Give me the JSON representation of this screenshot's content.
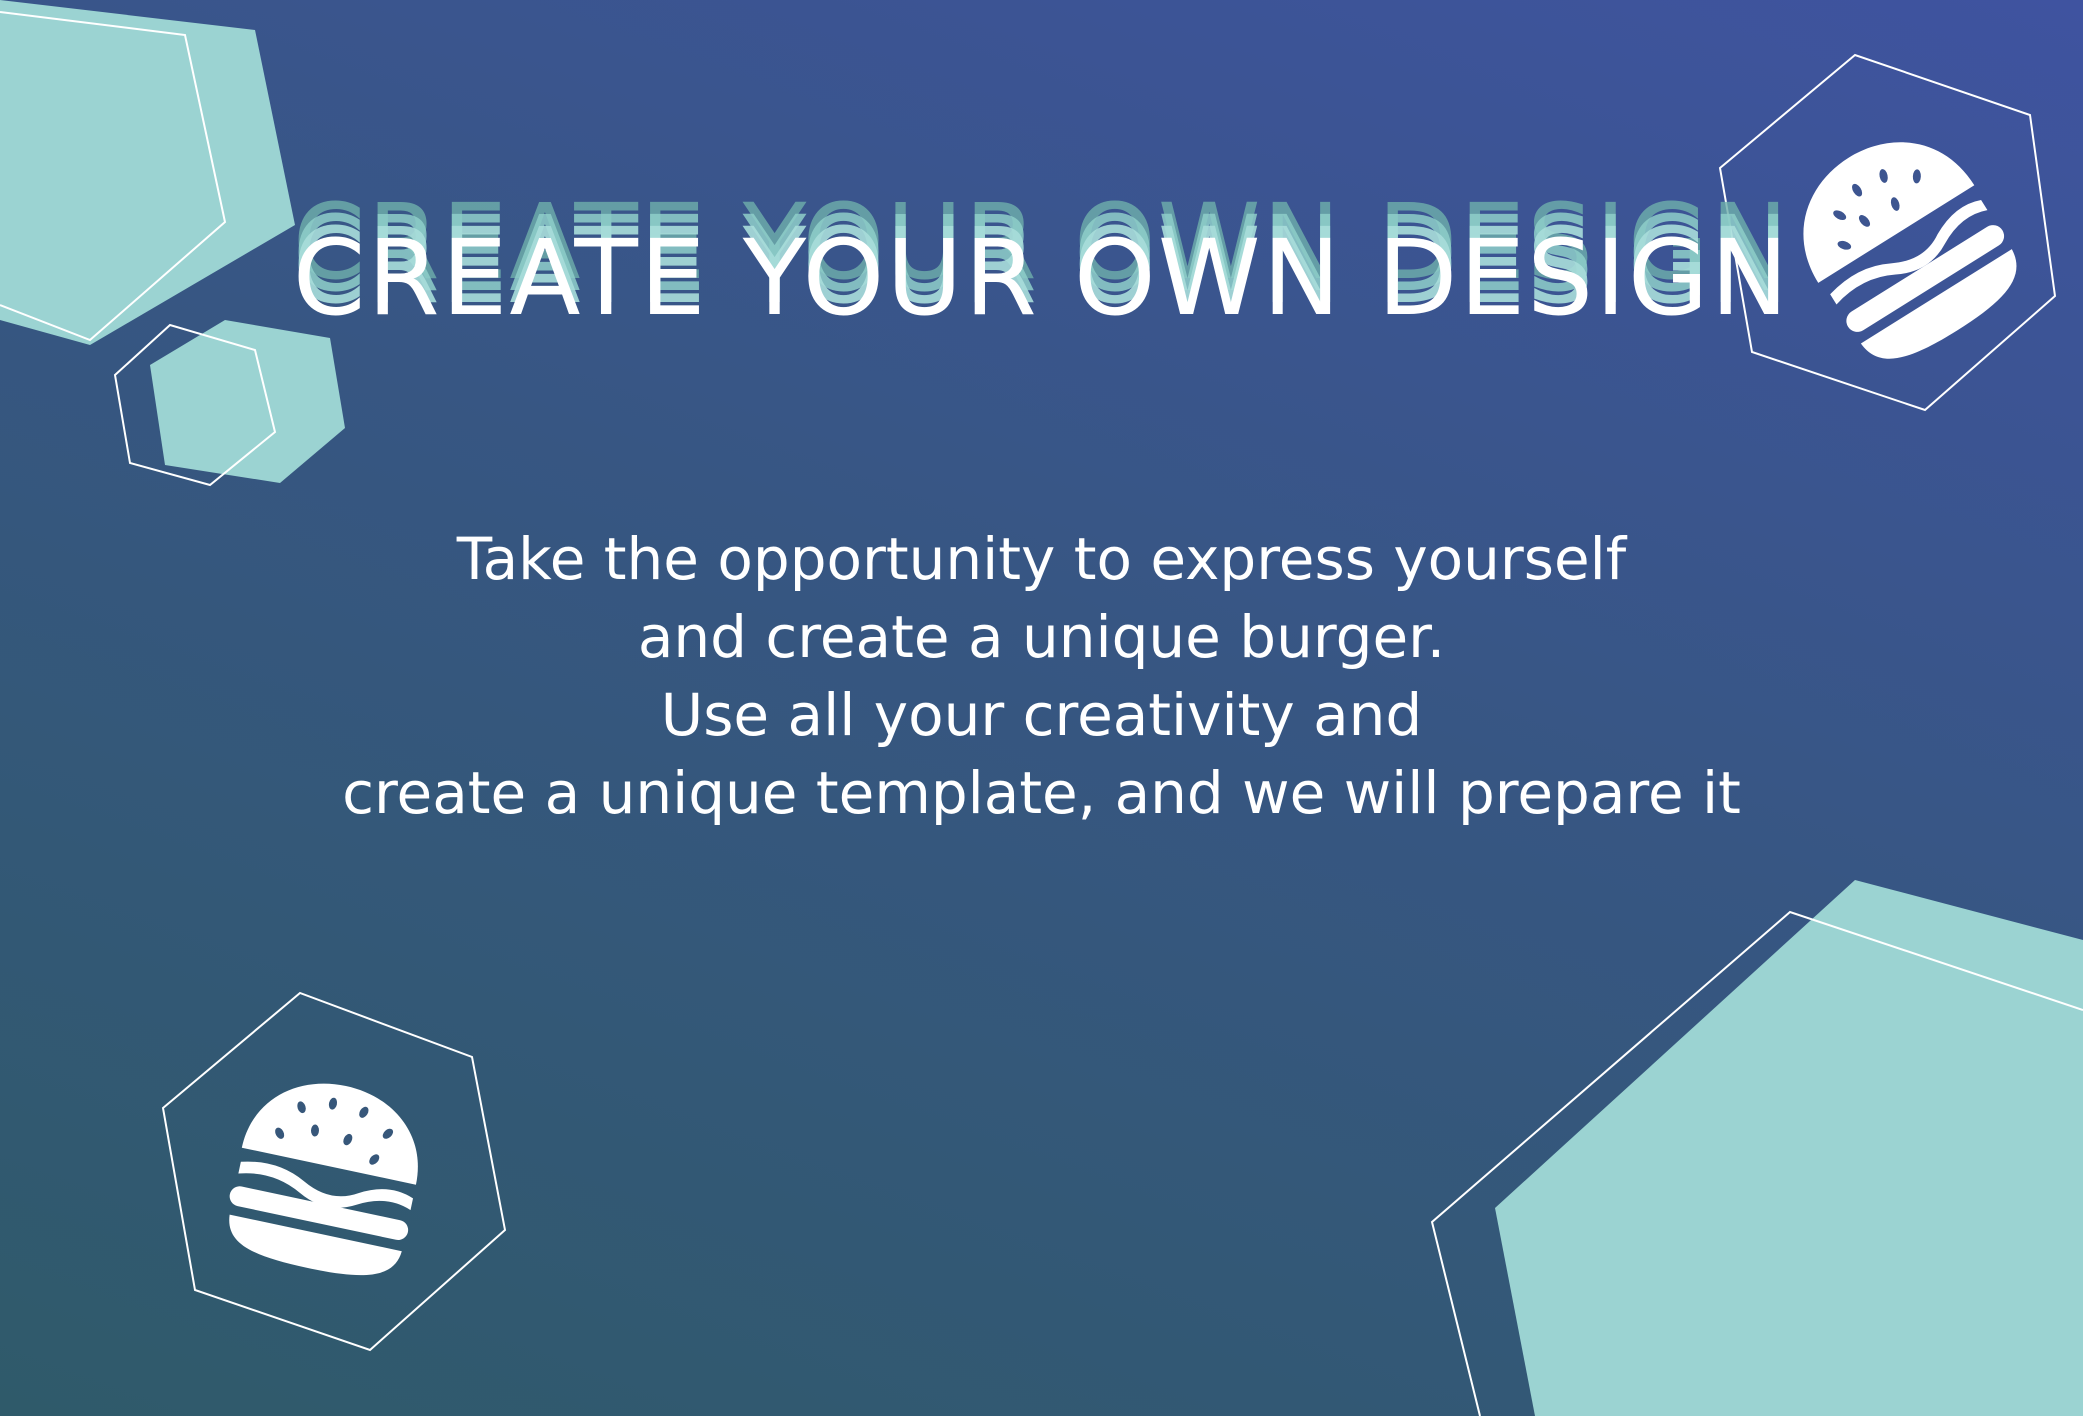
{
  "headline": "CREATE YOUR OWN DESIGN",
  "body_lines": [
    "Take the opportunity to express yourself",
    "and create a unique burger.",
    "Use all your creativity and",
    "create a unique template, and we will prepare it"
  ],
  "colors": {
    "background_start": "#3f53a0",
    "background_end": "#2f5a6a",
    "accent": "#9bd3d2",
    "text": "#ffffff"
  },
  "icons": [
    "burger-icon",
    "burger-icon"
  ]
}
